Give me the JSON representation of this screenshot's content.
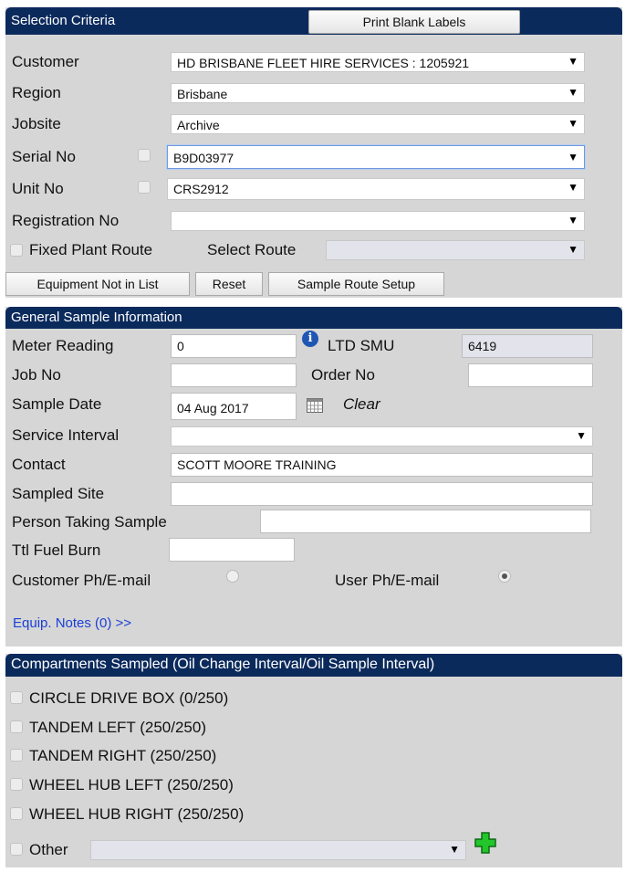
{
  "selection": {
    "header": "Selection Criteria",
    "print_blank_labels": "Print Blank Labels",
    "customer_label": "Customer",
    "customer_value": "HD BRISBANE FLEET HIRE SERVICES : 1205921",
    "region_label": "Region",
    "region_value": "Brisbane",
    "jobsite_label": "Jobsite",
    "jobsite_value": "Archive",
    "serial_label": "Serial No",
    "serial_value": "B9D03977",
    "unit_label": "Unit No",
    "unit_value": "CRS2912",
    "registration_label": "Registration No",
    "registration_value": "",
    "fixed_plant_label": "Fixed Plant Route",
    "select_route_label": "Select Route",
    "select_route_value": "",
    "buttons": {
      "equipment_not_in_list": "Equipment Not in List",
      "reset": "Reset",
      "sample_route_setup": "Sample Route Setup"
    }
  },
  "general": {
    "header": "General Sample Information",
    "meter_reading_label": "Meter Reading",
    "meter_reading_value": "0",
    "ltd_smu_label": "LTD SMU",
    "ltd_smu_value": "6419",
    "job_no_label": "Job No",
    "job_no_value": "",
    "order_no_label": "Order No",
    "order_no_value": "",
    "sample_date_label": "Sample Date",
    "sample_date_value": "04 Aug 2017",
    "clear_label": "Clear",
    "service_interval_label": "Service Interval",
    "service_interval_value": "",
    "contact_label": "Contact",
    "contact_value": "SCOTT MOORE TRAINING",
    "sampled_site_label": "Sampled Site",
    "sampled_site_value": "",
    "person_taking_label": "Person Taking Sample",
    "person_taking_value": "",
    "fuel_burn_label": "Ttl Fuel Burn",
    "fuel_burn_value": "",
    "customer_ph_label": "Customer Ph/E-mail",
    "user_ph_label": "User Ph/E-mail",
    "equip_notes_link": "Equip. Notes (0) >>"
  },
  "compartments": {
    "header": "Compartments Sampled (Oil Change Interval/Oil Sample Interval)",
    "items": [
      "CIRCLE DRIVE BOX (0/250)",
      "TANDEM LEFT (250/250)",
      "TANDEM RIGHT (250/250)",
      "WHEEL HUB LEFT (250/250)",
      "WHEEL HUB RIGHT (250/250)"
    ],
    "other_label": "Other",
    "other_value": ""
  },
  "colors": {
    "header_bg": "#0b2a5c",
    "panel_bg": "#d6d6d6",
    "link": "#1a3fd6",
    "add_icon": "#22c62a"
  }
}
